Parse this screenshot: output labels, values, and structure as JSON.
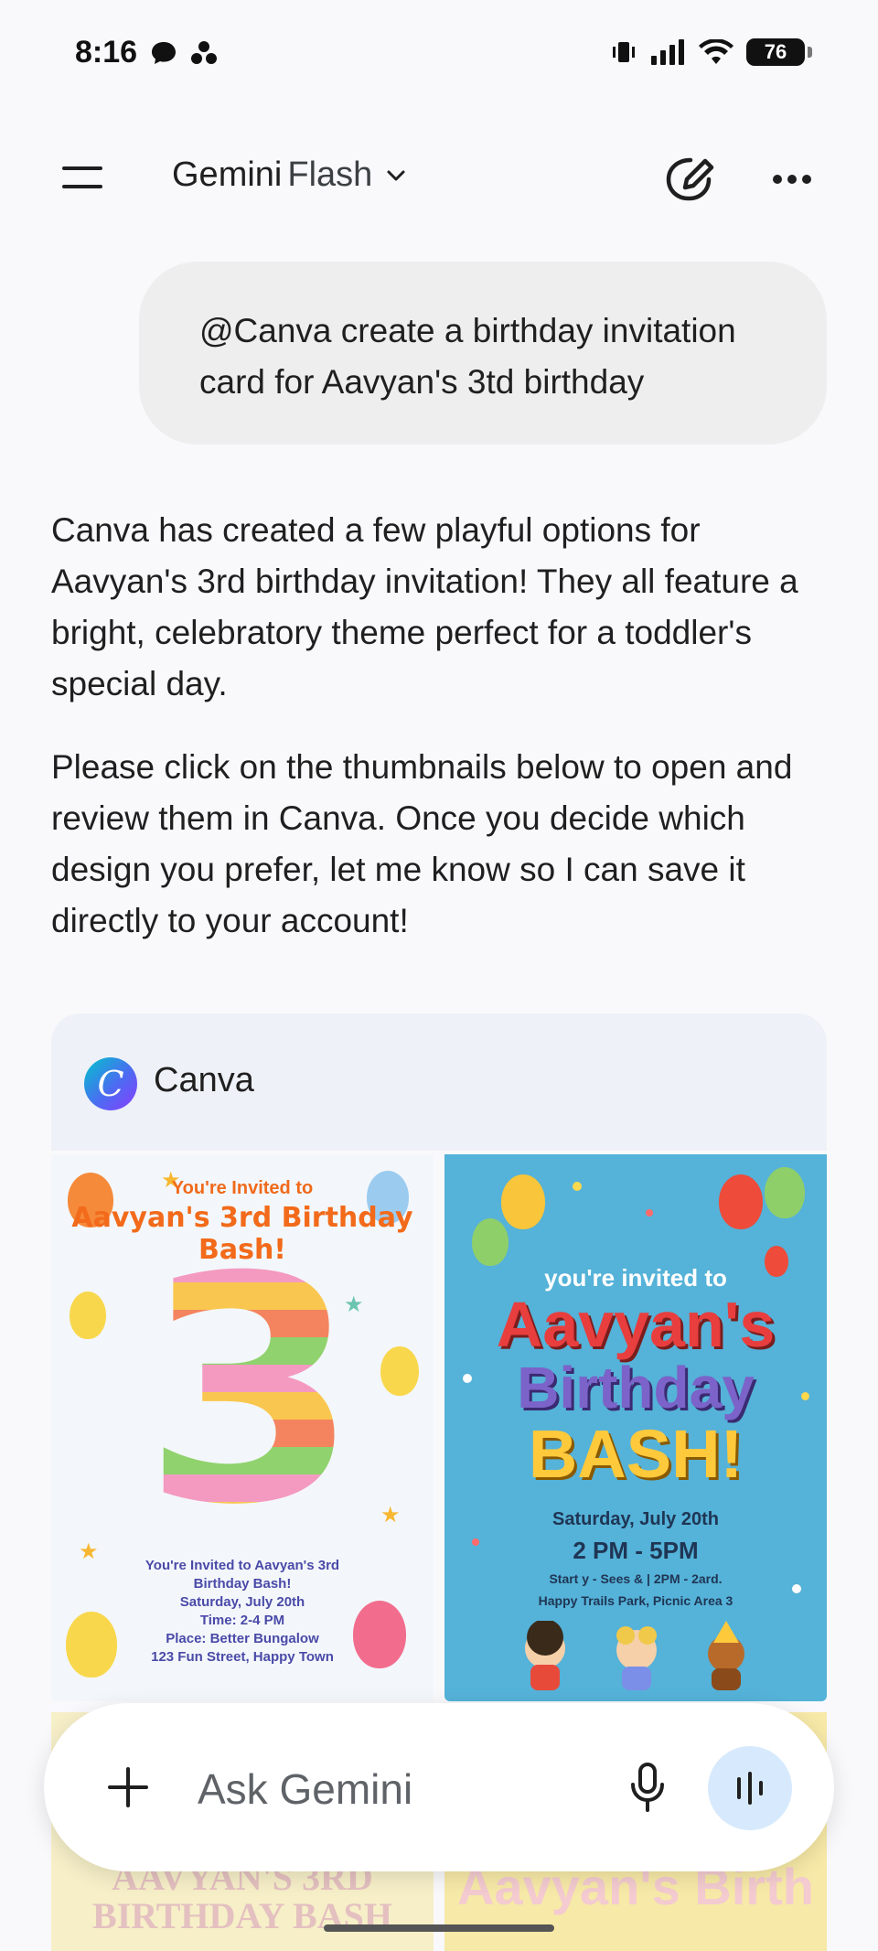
{
  "status_bar": {
    "time": "8:16",
    "battery": "76"
  },
  "header": {
    "model_name": "Gemini",
    "model_variant": "Flash"
  },
  "user_message": "@Canva create a birthday invitation card for Aavyan's 3td birthday",
  "response": {
    "paragraphs": [
      "Canva has created a few playful options for Aavyan's 3rd birthday invitation! They all feature a bright, celebratory theme perfect for a toddler's special day.",
      "Please click on the thumbnails below to open and review them in Canva. Once you decide which design you prefer, let me know so I can save it directly to your account!"
    ]
  },
  "canva": {
    "app_name": "Canva",
    "logo_letter": "C",
    "thumb1": {
      "invited": "You're Invited to",
      "headline": "Aavyan's 3rd Birthday Bash!",
      "number": "3",
      "details": [
        "You're Invited to Aavyan's 3rd",
        "Birthday Bash!",
        "Saturday, July 20th",
        "Time: 2-4 PM",
        "Place: Better Bungalow",
        "123 Fun Street, Happy Town"
      ]
    },
    "thumb2": {
      "invited": "you're invited to",
      "name": "Aavyan's",
      "line2": "Birthday",
      "line3": "BASH!",
      "date": "Saturday, July 20th",
      "time": "2 PM - 5PM",
      "line_a": "Start y - Sees & | 2PM - 2ard.",
      "line_b": "Happy Trails Park, Picnic Area 3"
    },
    "thumb3_partial": "AAVYAN'S 3RD BIRTHDAY BASH",
    "thumb4_partial": "Aavyan's Birth"
  },
  "composer": {
    "placeholder": "Ask Gemini"
  },
  "icons": {
    "menu": "menu-icon",
    "dropdown": "chevron-down-icon",
    "new_chat": "edit-icon",
    "more": "more-icon",
    "plus": "plus-icon",
    "mic": "mic-icon",
    "voice": "voice-wave-icon"
  }
}
